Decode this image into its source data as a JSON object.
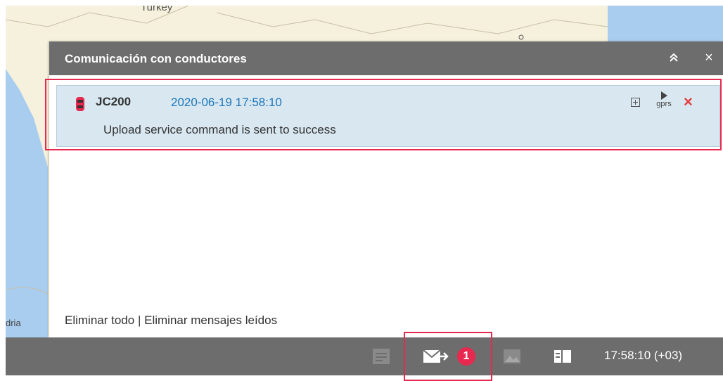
{
  "map": {
    "label_top": "Turkey",
    "label_left": "dria"
  },
  "panel": {
    "title": "Comunicación con conductores",
    "collapse_label": "⌃⌃",
    "close_label": "×"
  },
  "message": {
    "device": "JC200",
    "timestamp": "2020-06-19 17:58:10",
    "text": "Upload service command is sent to success",
    "gprs_label": "gprs",
    "delete_label": "×",
    "expand_label": "+"
  },
  "footer": {
    "delete_all": "Eliminar todo",
    "separator": "|",
    "delete_read": "Eliminar mensajes leídos"
  },
  "taskbar": {
    "badge_count": "1",
    "clock": "17:58:10 (+03)"
  },
  "colors": {
    "accent": "#e8294f",
    "header_bg": "#6d6d6d",
    "timestamp": "#1b76bd",
    "message_bg": "#d8e7f0"
  }
}
